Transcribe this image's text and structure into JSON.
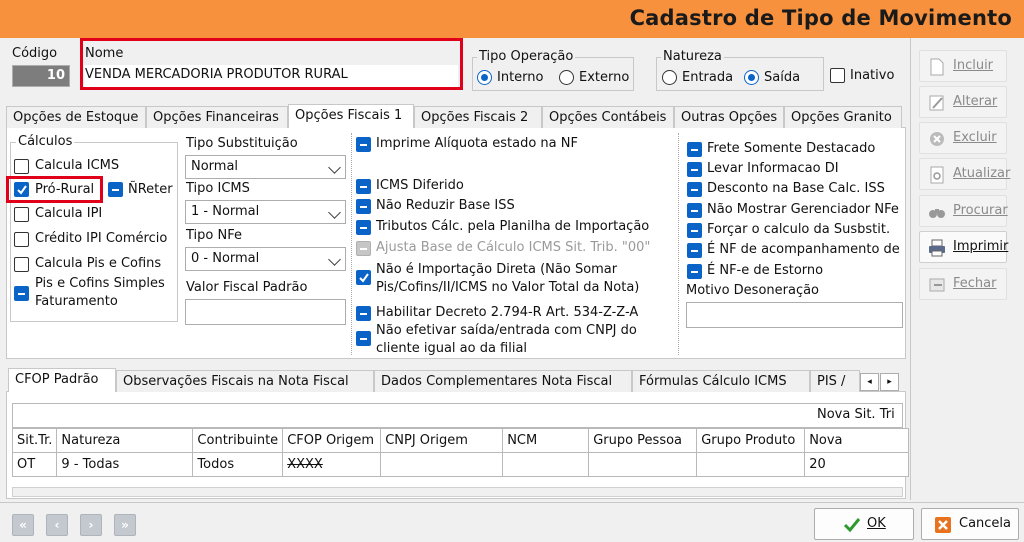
{
  "window": {
    "title": "Cadastro de Tipo de Movimento"
  },
  "header": {
    "codigo_label": "Código",
    "codigo_value": "10",
    "nome_label": "Nome",
    "nome_value": "VENDA MERCADORIA PRODUTOR RURAL",
    "tipo_operacao_label": "Tipo Operação",
    "interno_label": "Interno",
    "externo_label": "Externo",
    "natureza_label": "Natureza",
    "entrada_label": "Entrada",
    "saida_label": "Saída",
    "inativo_label": "Inativo"
  },
  "tabs": [
    "Opções de Estoque",
    "Opções Financeiras",
    "Opções Fiscais 1",
    "Opções Fiscais 2",
    "Opções Contábeis",
    "Outras Opções",
    "Opções Granito"
  ],
  "calculos": {
    "title": "Cálculos",
    "calcula_icms": "Calcula ICMS",
    "pro_rural": "Pró-Rural",
    "nreter": "ÑReter",
    "calcula_ipi": "Calcula IPI",
    "credito_ipi": "Crédito IPI Comércio",
    "calcula_pis": "Calcula Pis e Cofins",
    "pis_simples_1": "Pis e Cofins Simples",
    "pis_simples_2": "Faturamento"
  },
  "mid": {
    "tipo_subst_label": "Tipo Substituição",
    "tipo_subst_value": "Normal",
    "tipo_icms_label": "Tipo ICMS",
    "tipo_icms_value": "1 - Normal",
    "tipo_nfe_label": "Tipo NFe",
    "tipo_nfe_value": "0 - Normal",
    "valor_fiscal_label": "Valor Fiscal Padrão",
    "valor_fiscal_value": ""
  },
  "fiscal_options": {
    "imprime_aliquota": "Imprime Alíquota estado na NF",
    "icms_diferido": "ICMS Diferido",
    "nao_reduzir": "Não Reduzir Base ISS",
    "tributos": "Tributos Cálc. pela Planilha de Importação",
    "ajusta_base": "Ajusta Base de Cálculo ICMS Sit. Trib. \"00\"",
    "nao_importacao_1": "Não é Importação Direta (Não Somar",
    "nao_importacao_2": "Pis/Cofins/II/ICMS  no Valor Total da Nota)",
    "habilitar": "Habilitar Decreto 2.794-R Art. 534-Z-Z-A",
    "nao_efetivar_1": "Não efetivar saída/entrada com CNPJ do",
    "nao_efetivar_2": "cliente igual ao da filial"
  },
  "right_options": {
    "frete": "Frete Somente Destacado",
    "levar": "Levar Informacao DI",
    "desconto": "Desconto na Base Calc. ISS",
    "nao_mostrar": "Não Mostrar Gerenciador NFe",
    "forcar": "Forçar o calculo da Susbstit.",
    "nf_acomp": "É NF de acompanhamento de",
    "nfe_estorno": "É NF-e de Estorno",
    "motivo_label": "Motivo Desoneração",
    "motivo_value": ""
  },
  "lower_tabs": [
    "CFOP Padrão",
    "Observações Fiscais na Nota Fiscal",
    "Dados Complementares Nota Fiscal",
    "Fórmulas Cálculo ICMS",
    "PIS /"
  ],
  "grid": {
    "group_header": "Nova Sit. Tri",
    "columns": [
      "Sit.Tr.",
      "Natureza",
      "Contribuinte",
      "CFOP Origem",
      "CNPJ Origem",
      "NCM",
      "Grupo Pessoa",
      "Grupo Produto",
      "Nova"
    ],
    "rows": [
      [
        "OT",
        "9 - Todas",
        "Todos",
        "XXXX",
        "",
        "",
        "",
        "",
        "20"
      ]
    ]
  },
  "side_buttons": [
    "Incluir",
    "Alterar",
    "Excluir",
    "Atualizar",
    "Procurar",
    "Imprimir",
    "Fechar"
  ],
  "footer": {
    "ok_label": "OK",
    "cancel_label": "Cancela"
  },
  "colors": {
    "title_bar": "#f7913d",
    "highlight": "#e0001a",
    "accent": "#0a64c8"
  }
}
